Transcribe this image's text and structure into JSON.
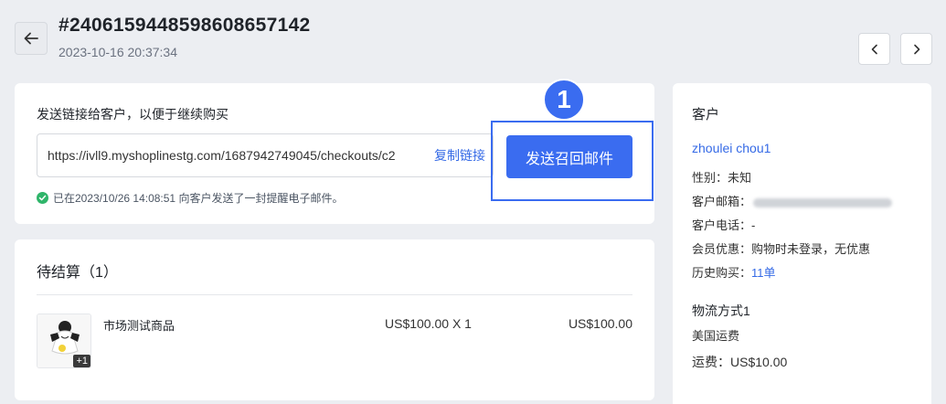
{
  "header": {
    "order_id": "#2406159448598608657142",
    "order_time": "2023-10-16 20:37:34"
  },
  "send_card": {
    "title": "发送链接给客户，以便于继续购买",
    "link_value": "https://ivll9.myshoplinestg.com/1687942749045/checkouts/c2",
    "copy_label": "复制链接",
    "send_button": "发送召回邮件",
    "step_number": "1",
    "status_text": "已在2023/10/26 14:08:51 向客户发送了一封提醒电子邮件。"
  },
  "pending_card": {
    "title": "待结算（1）",
    "items": [
      {
        "name": "市场测试商品",
        "qty_text": "US$100.00 X 1",
        "total": "US$100.00",
        "thumb_badge": "+1"
      }
    ]
  },
  "customer_card": {
    "heading": "客户",
    "name": "zhoulei chou1",
    "gender_label": "性别：",
    "gender_value": "未知",
    "email_label": "客户邮箱：",
    "phone_label": "客户电话：",
    "phone_value": "-",
    "member_label": "会员优惠：",
    "member_value": "购物时未登录，无优惠",
    "history_label": "历史购买：",
    "history_value": "11单",
    "shipping_heading": "物流方式1",
    "shipping_method": "美国运费",
    "shipping_fee_label": "运费：",
    "shipping_fee_value": "US$10.00"
  },
  "colors": {
    "accent": "#3a6cf0",
    "link": "#356ae6",
    "success": "#2fb56a",
    "background": "#eceef2"
  },
  "icons": [
    "arrow-left-icon",
    "chevron-left-icon",
    "chevron-right-icon",
    "check-circle-icon"
  ]
}
